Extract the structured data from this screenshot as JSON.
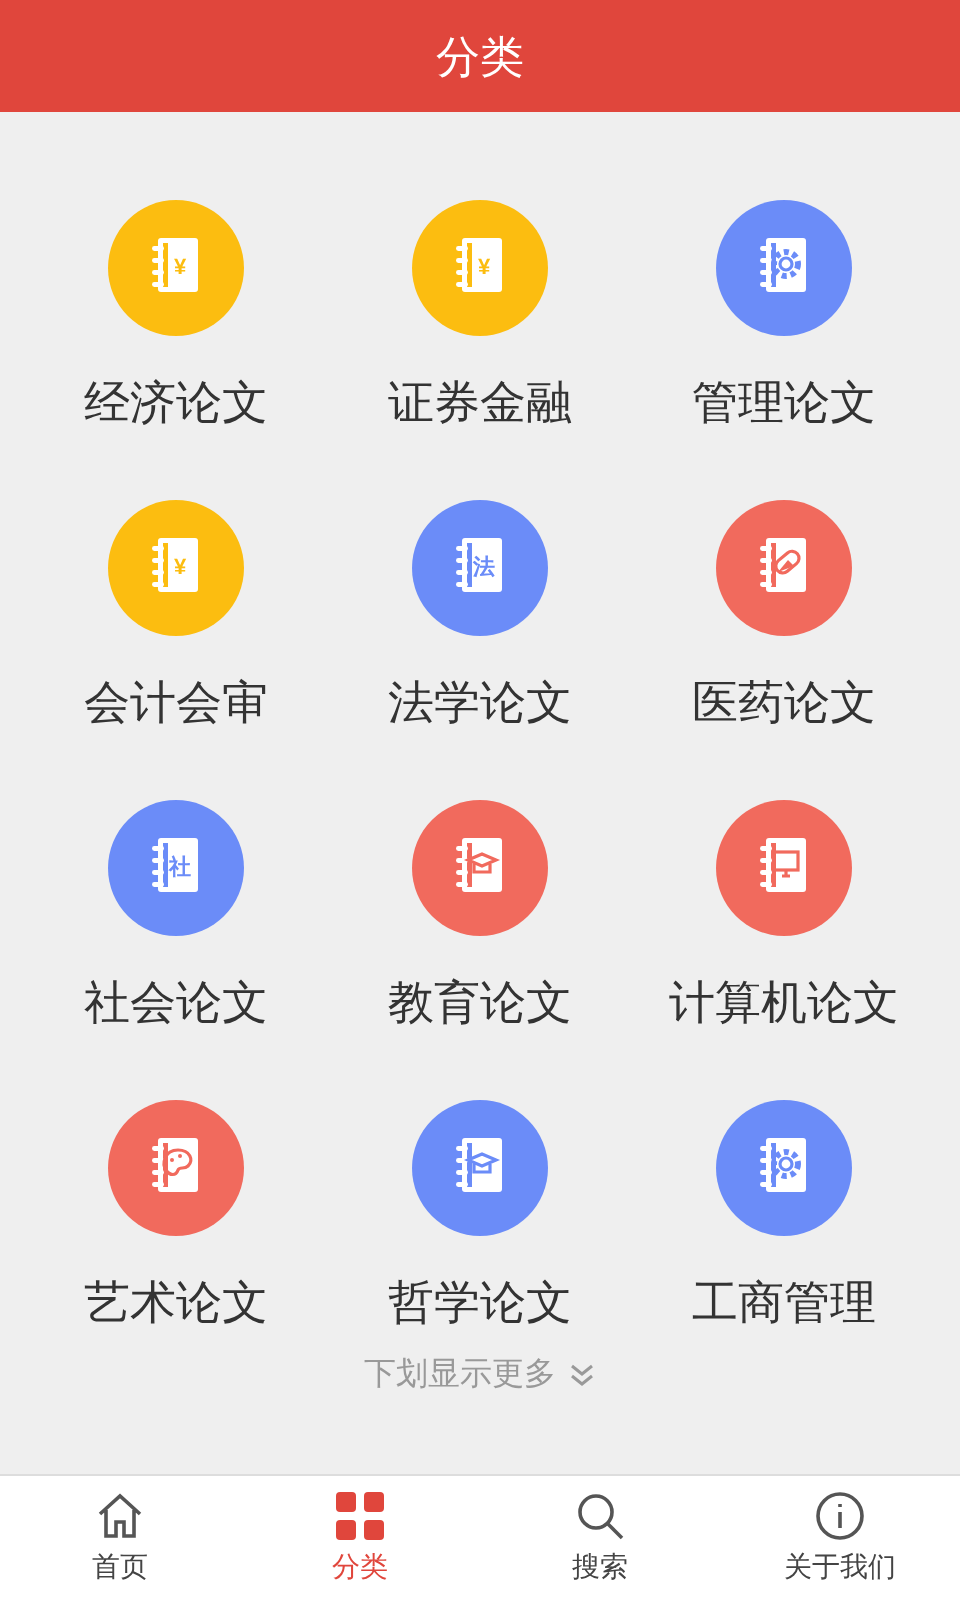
{
  "header": {
    "title": "分类"
  },
  "categories": [
    {
      "label": "经济论文",
      "color": "#fcbd10",
      "kind": "glyph",
      "glyph": "¥"
    },
    {
      "label": "证券金融",
      "color": "#fcbd10",
      "kind": "glyph",
      "glyph": "¥"
    },
    {
      "label": "管理论文",
      "color": "#6b8cf8",
      "kind": "gear"
    },
    {
      "label": "会计会审",
      "color": "#fcbd10",
      "kind": "glyph",
      "glyph": "¥"
    },
    {
      "label": "法学论文",
      "color": "#6b8cf8",
      "kind": "glyph",
      "glyph": "法"
    },
    {
      "label": "医药论文",
      "color": "#f16a5d",
      "kind": "pill"
    },
    {
      "label": "社会论文",
      "color": "#6b8cf8",
      "kind": "glyph",
      "glyph": "社"
    },
    {
      "label": "教育论文",
      "color": "#f16a5d",
      "kind": "cap"
    },
    {
      "label": "计算机论文",
      "color": "#f16a5d",
      "kind": "monitor"
    },
    {
      "label": "艺术论文",
      "color": "#f16a5d",
      "kind": "palette"
    },
    {
      "label": "哲学论文",
      "color": "#6b8cf8",
      "kind": "cap"
    },
    {
      "label": "工商管理",
      "color": "#6b8cf8",
      "kind": "gear"
    }
  ],
  "more": {
    "label": "下划显示更多"
  },
  "nav": [
    {
      "label": "首页",
      "kind": "home",
      "selected": false
    },
    {
      "label": "分类",
      "kind": "grid",
      "selected": true
    },
    {
      "label": "搜索",
      "kind": "search",
      "selected": false
    },
    {
      "label": "关于我们",
      "kind": "info",
      "selected": false
    }
  ]
}
